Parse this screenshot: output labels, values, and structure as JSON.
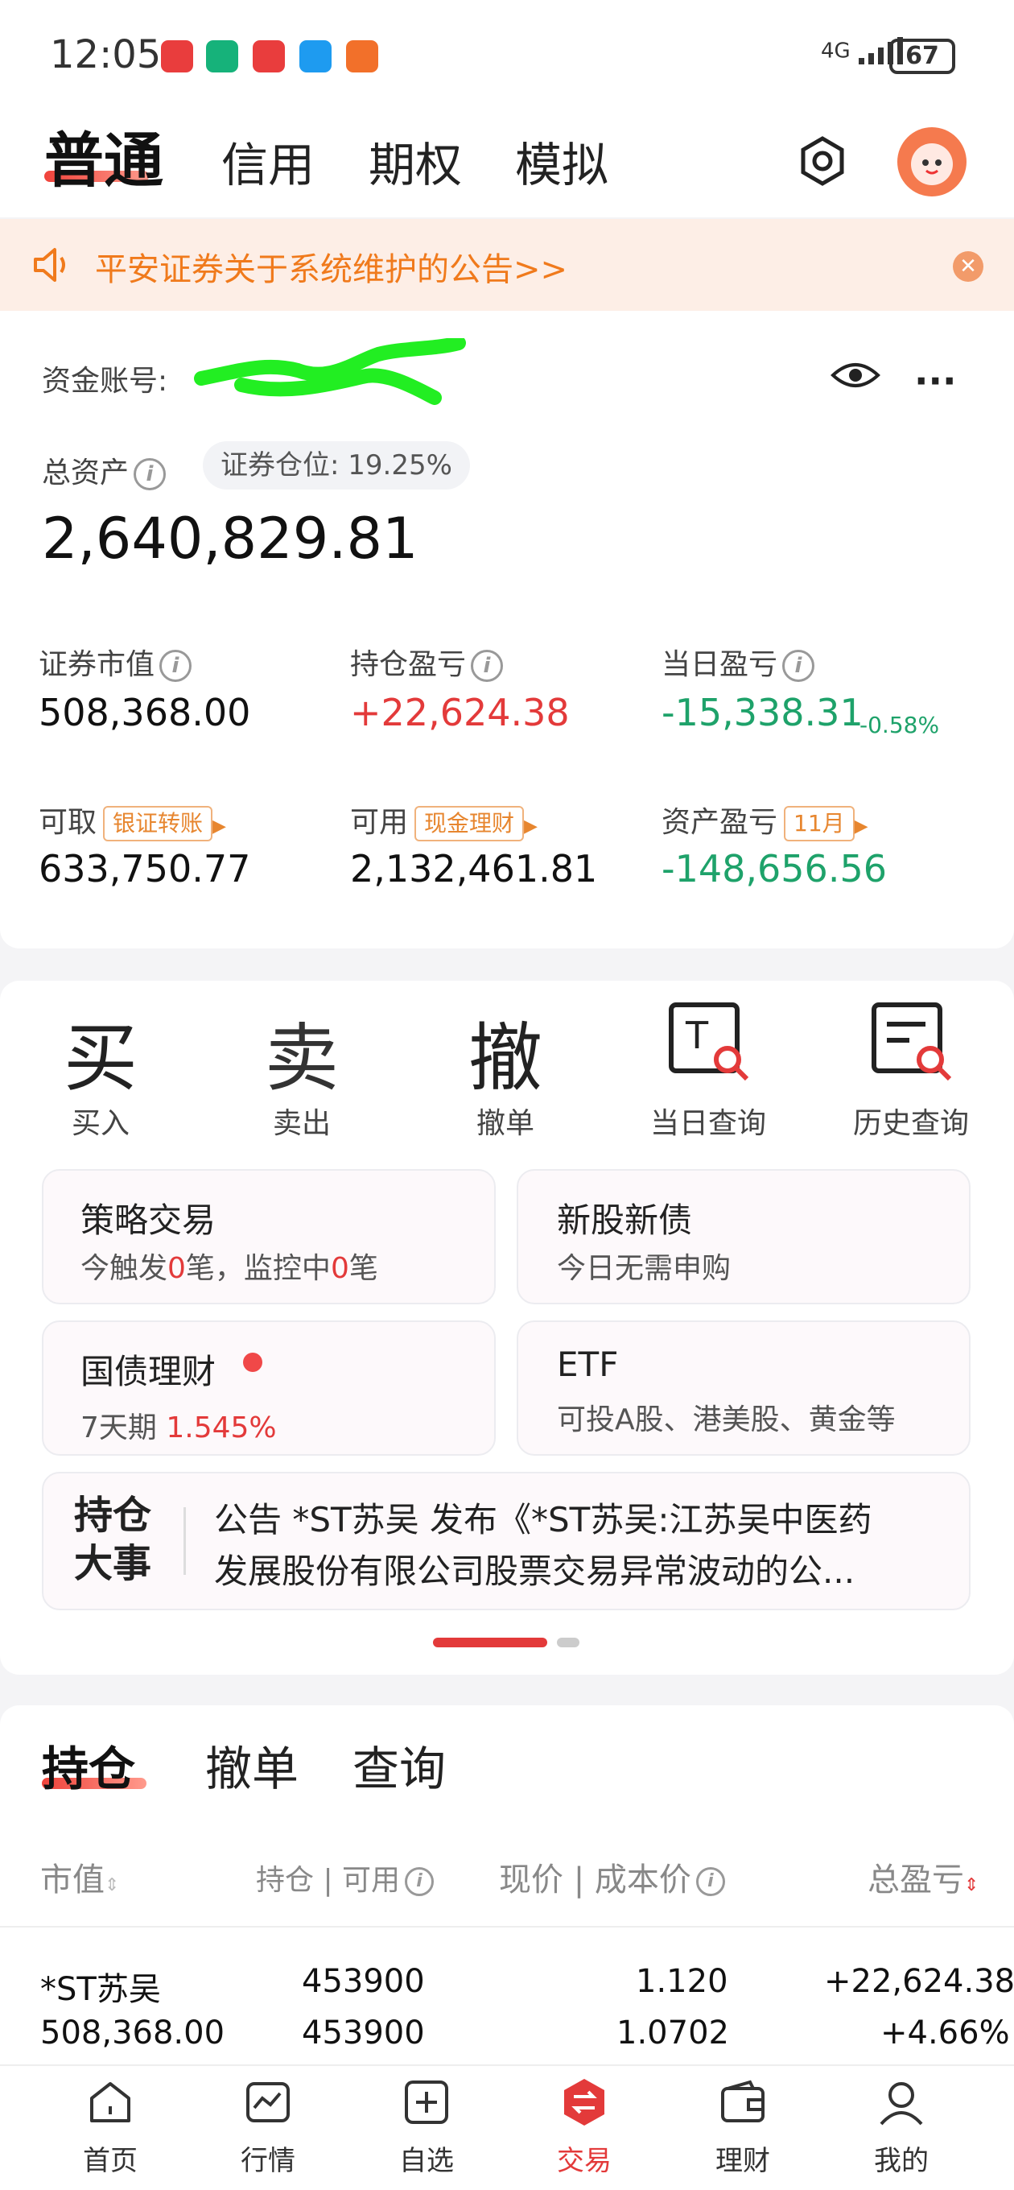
{
  "status": {
    "time": "12:05",
    "signal": "4G",
    "battery": "67"
  },
  "top_tabs": {
    "active": "普通",
    "others": [
      "信用",
      "期权",
      "模拟"
    ]
  },
  "notice": {
    "text": "平安证券关于系统维护的公告>>"
  },
  "account": {
    "account_label": "资金账号:",
    "total_asset_label": "总资产",
    "position_ratio": "证券仓位: 19.25%",
    "total_asset": "2,640,829.81",
    "market_value_label": "证券市值",
    "market_value": "508,368.00",
    "holding_pl_label": "持仓盈亏",
    "holding_pl": "+22,624.38",
    "daily_pl_label": "当日盈亏",
    "daily_pl": "-15,338.31",
    "daily_pl_pct": "-0.58%",
    "withdrawable_label": "可取",
    "withdrawable": "633,750.77",
    "transfer_chip": "银证转账",
    "available_label": "可用",
    "available": "2,132,461.81",
    "cash_chip": "现金理财",
    "asset_pl_label": "资产盈亏",
    "asset_pl": "-148,656.56",
    "month_chip": "11月"
  },
  "functions": [
    {
      "glyph": "买",
      "label": "买入"
    },
    {
      "glyph": "卖",
      "label": "卖出"
    },
    {
      "glyph": "撤",
      "label": "撤单"
    },
    {
      "glyph": "",
      "label": "当日查询"
    },
    {
      "glyph": "",
      "label": "历史查询"
    }
  ],
  "boxes": {
    "strategy_title": "策略交易",
    "strategy_sub_a": "今触发",
    "strategy_count1": "0",
    "strategy_sub_b": "笔，监控中",
    "strategy_count2": "0",
    "strategy_sub_c": "笔",
    "ipo_title": "新股新债",
    "ipo_sub": "今日无需申购",
    "bond_title": "国债理财",
    "bond_sub_a": "7天期",
    "bond_rate": "1.545%",
    "etf_title": "ETF",
    "etf_sub": "可投A股、港美股、黄金等",
    "event_tag1": "持仓",
    "event_tag2": "大事",
    "event_line1": "公告 *ST苏吴 发布《*ST苏吴:江苏吴中医药",
    "event_line2": "发展股份有限公司股票交易异常波动的公..."
  },
  "positions": {
    "tabs": [
      "持仓",
      "撤单",
      "查询"
    ],
    "columns": {
      "c1": "市值",
      "c2": "持仓 | 可用",
      "c3": "现价 | 成本价",
      "c4": "总盈亏"
    },
    "rows": [
      {
        "name": "*ST苏吴",
        "value": "508,368.00",
        "hold": "453900",
        "avail": "453900",
        "price": "1.120",
        "cost": "1.0702",
        "pl": "+22,624.38",
        "pl_pct": "+4.66%"
      }
    ]
  },
  "nav": [
    "首页",
    "行情",
    "自选",
    "交易",
    "理财",
    "我的"
  ],
  "colors": {
    "accent": "#e33a3a",
    "green": "#1ea26a",
    "orange": "#f07a1c"
  }
}
